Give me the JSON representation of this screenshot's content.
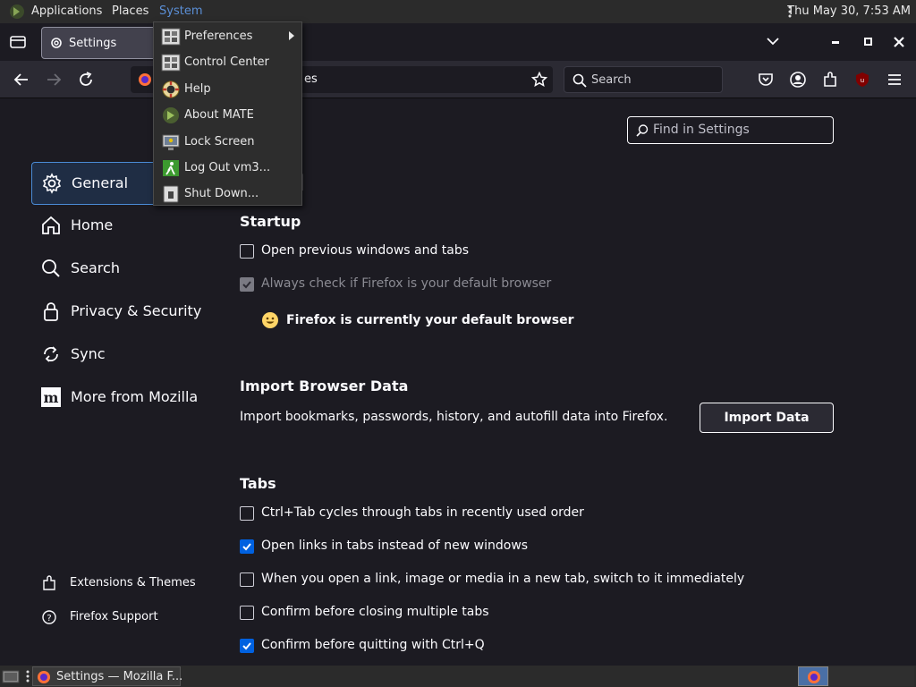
{
  "top_panel": {
    "menus": [
      "Applications",
      "Places",
      "System"
    ],
    "clock": "Thu May 30,  7:53 AM"
  },
  "titlebar": {
    "tab_title": "Settings"
  },
  "navbar": {
    "url_text": "es",
    "search_placeholder": "Search"
  },
  "system_menu": {
    "items": [
      {
        "label": "Preferences",
        "icon": "preferences-icon",
        "has_submenu": true
      },
      {
        "label": "Control Center",
        "icon": "control-center-icon"
      },
      {
        "label": "Help",
        "icon": "help-icon"
      },
      {
        "label": "About MATE",
        "icon": "about-mate-icon"
      },
      {
        "label": "Lock Screen",
        "icon": "lock-screen-icon"
      },
      {
        "label": "Log Out vm3...",
        "icon": "log-out-icon"
      },
      {
        "label": "Shut Down...",
        "icon": "shut-down-icon"
      }
    ]
  },
  "settings": {
    "find_placeholder": "Find in Settings",
    "page_heading": "l",
    "categories": [
      {
        "label": "General",
        "icon": "gear-icon",
        "selected": true
      },
      {
        "label": "Home",
        "icon": "home-icon"
      },
      {
        "label": "Search",
        "icon": "search-icon"
      },
      {
        "label": "Privacy & Security",
        "icon": "lock-icon"
      },
      {
        "label": "Sync",
        "icon": "sync-icon"
      },
      {
        "label": "More from Mozilla",
        "icon": "mozilla-icon"
      }
    ],
    "footer_links": [
      {
        "label": "Extensions & Themes",
        "icon": "puzzle-icon"
      },
      {
        "label": "Firefox Support",
        "icon": "help-circle-icon"
      }
    ],
    "startup": {
      "title": "Startup",
      "open_previous": {
        "label": "Open previous windows and tabs",
        "checked": false
      },
      "always_check": {
        "label": "Always check if Firefox is your default browser",
        "checked": true,
        "disabled": true
      },
      "default_status": "Firefox is currently your default browser"
    },
    "import": {
      "title": "Import Browser Data",
      "description": "Import bookmarks, passwords, history, and autofill data into Firefox.",
      "button_label": "Import Data"
    },
    "tabs": {
      "title": "Tabs",
      "options": [
        {
          "label": "Ctrl+Tab cycles through tabs in recently used order",
          "checked": false
        },
        {
          "label": "Open links in tabs instead of new windows",
          "checked": true
        },
        {
          "label": "When you open a link, image or media in a new tab, switch to it immediately",
          "checked": false
        },
        {
          "label": "Confirm before closing multiple tabs",
          "checked": false
        },
        {
          "label": "Confirm before quitting with Ctrl+Q",
          "checked": true
        }
      ]
    }
  },
  "bottom_panel": {
    "task_label": "Settings — Mozilla F..."
  },
  "colors": {
    "accent": "#0061e0",
    "background": "#1c1b22",
    "selected_category_bg": "#1f2d44"
  }
}
